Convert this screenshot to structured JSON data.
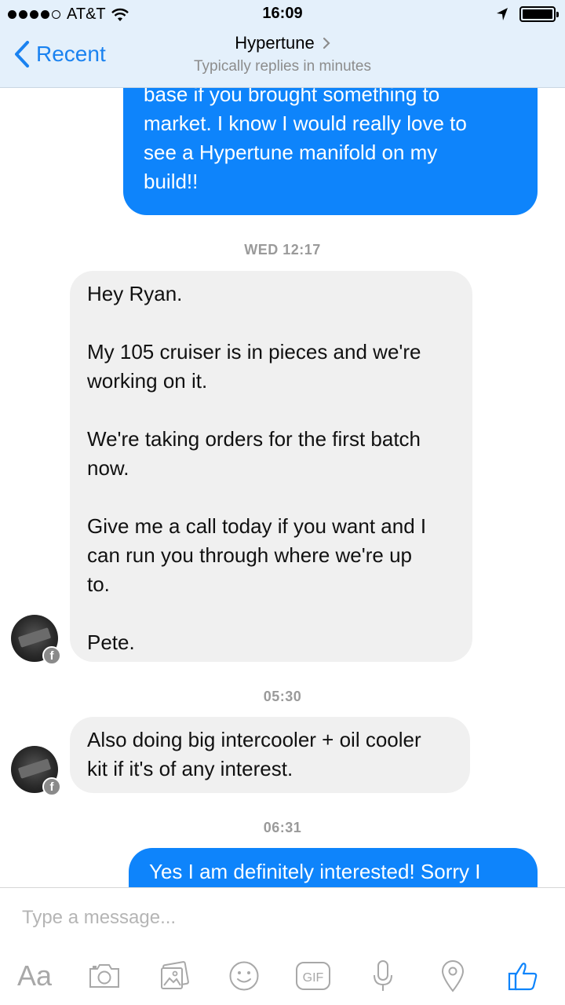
{
  "status_bar": {
    "carrier": "AT&T",
    "time": "16:09"
  },
  "header": {
    "back_label": "Recent",
    "title": "Hypertune",
    "subtitle": "Typically replies in minutes"
  },
  "messages": [
    {
      "type": "out",
      "text": "base if you brought something to\nmarket.  I know I would really love to\nsee a Hypertune manifold on my\nbuild!!"
    },
    {
      "type": "stamp",
      "text": "WED 12:17"
    },
    {
      "type": "in",
      "text": "Hey Ryan.\n\nMy 105 cruiser is in pieces and we're\nworking on it.\n\nWe're taking orders for the first batch\nnow.\n\nGive me a call today if you want and I\ncan run you through where we're up\nto.\n\nPete."
    },
    {
      "type": "stamp",
      "text": "05:30"
    },
    {
      "type": "in",
      "text": "Also doing big intercooler + oil cooler\nkit if it's of any interest."
    },
    {
      "type": "stamp",
      "text": "06:31"
    },
    {
      "type": "out",
      "text": "Yes I am definitely interested!  Sorry I"
    }
  ],
  "composer": {
    "placeholder": "Type a message...",
    "aa_label": "Aa",
    "gif_label": "GIF"
  },
  "colors": {
    "accent": "#0e84fb",
    "header_bg": "#e4f0fb",
    "incoming_bg": "#f0f0f0",
    "icon_gray": "#a8a8a8"
  }
}
